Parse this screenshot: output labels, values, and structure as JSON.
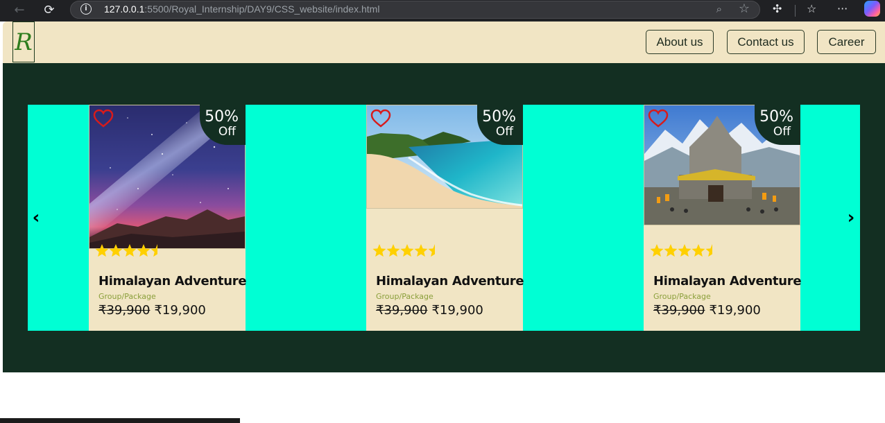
{
  "browser": {
    "url_host": "127.0.0.1",
    "url_path": ":5500/Royal_Internship/DAY9/CSS_website/index.html",
    "icons": [
      "back-icon",
      "reload-icon",
      "info-icon",
      "zoom-icon",
      "favorite-star-icon",
      "extensions-icon",
      "favorites-icon",
      "more-icon",
      "copilot-icon"
    ]
  },
  "header": {
    "logo": "R",
    "nav": {
      "about": "About us",
      "contact": "Contact us",
      "career": "Career"
    }
  },
  "slider": {
    "prev_icon": "‹",
    "next_icon": "›",
    "cards": [
      {
        "image": "galaxy-mountain-painting",
        "discount_pct": "50%",
        "discount_word": "Off",
        "rating": 4.5,
        "title": "Himalayan Adventure",
        "subtitle": "Group/Package",
        "old_price": "₹39,900",
        "new_price": "₹19,900"
      },
      {
        "image": "tropical-beach",
        "discount_pct": "50%",
        "discount_word": "Off",
        "rating": 4.5,
        "title": "Himalayan Adventure",
        "subtitle": "Group/Package",
        "old_price": "₹39,900",
        "new_price": "₹19,900"
      },
      {
        "image": "kedarnath-temple",
        "discount_pct": "50%",
        "discount_word": "Off",
        "rating": 4.5,
        "title": "Himalayan Adventure",
        "subtitle": "Group/Package",
        "old_price": "₹39,900",
        "new_price": "₹19,900"
      }
    ]
  },
  "colors": {
    "header_bg": "#f1e5c4",
    "hero_bg": "#132f22",
    "slider_bg": "#00ffd4",
    "card_bg": "#f1e5c4",
    "star": "#ffd000",
    "heart": "#d81b1b"
  }
}
